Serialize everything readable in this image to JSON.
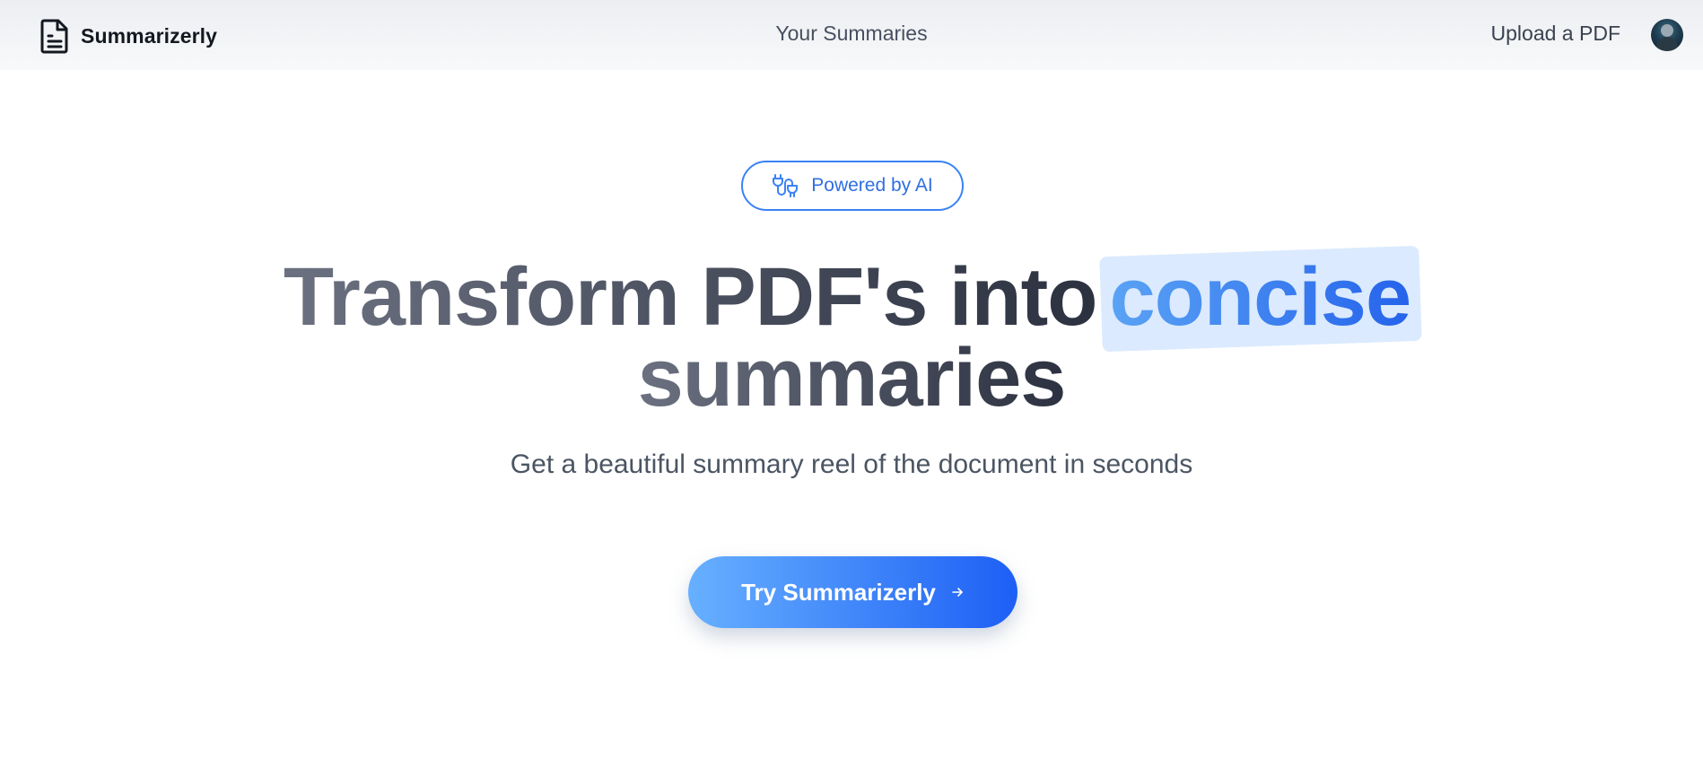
{
  "nav": {
    "brand": "Summarizerly",
    "links": {
      "summaries": "Your Summaries",
      "upload": "Upload a PDF"
    }
  },
  "hero": {
    "badge": "Powered by AI",
    "headline": {
      "part1": "Transform PDF's into",
      "highlight": "concise",
      "part2": "summaries"
    },
    "subtitle": "Get a beautiful summary reel of the document in seconds",
    "cta": "Try Summarizerly"
  },
  "icons": {
    "logo": "document-icon",
    "badge": "plug-icon",
    "cta": "arrow-right-icon",
    "avatar": "user-avatar"
  },
  "colors": {
    "accent": "#3b82f6",
    "cta_start": "#67b0ff",
    "cta_end": "#1d5ff5",
    "highlight_bg": "#dbeafe",
    "heading": "#2c3140"
  }
}
